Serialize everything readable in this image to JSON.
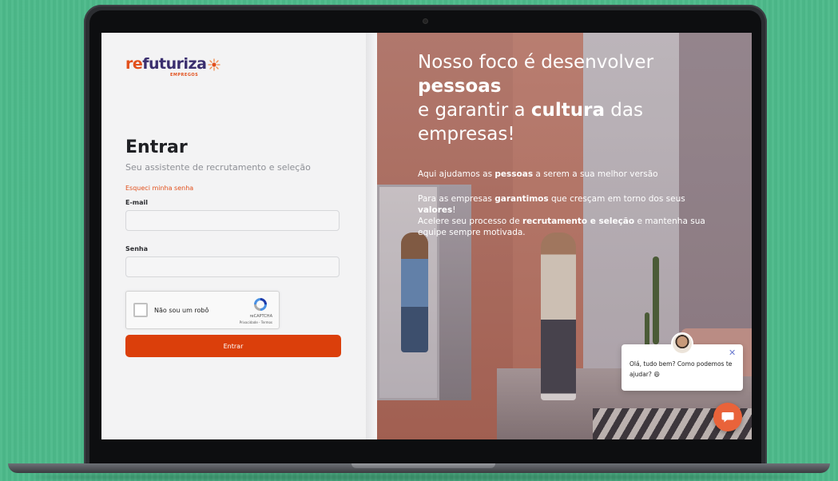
{
  "brand": {
    "logo_re": "re",
    "logo_rest": "futuriza",
    "logo_sub": "EMPREGOS",
    "primary_color": "#e2501c",
    "button_color": "#db3f0b",
    "background_color": "#4cb98a"
  },
  "login": {
    "title": "Entrar",
    "subtitle": "Seu assistente de recrutamento e seleção",
    "forgot_password": "Esqueci minha senha",
    "email_label": "E-mail",
    "email_value": "",
    "password_label": "Senha",
    "password_value": "",
    "submit_label": "Entrar"
  },
  "captcha": {
    "label": "Não sou um robô",
    "brand": "reCAPTCHA",
    "links": "Privacidade - Termos",
    "checked": false
  },
  "hero": {
    "line1": "Nosso foco é desenvolver",
    "line2_bold": "pessoas",
    "line3_pre": "e garantir a ",
    "line3_bold": "cultura",
    "line3_post": " das",
    "line4": "empresas!",
    "p1_pre": "Aqui ajudamos as ",
    "p1_bold": "pessoas",
    "p1_post": " a serem a sua melhor versão",
    "p2_pre": "Para as empresas ",
    "p2_bold": "garantimos",
    "p2_post": " que cresçam em torno dos seus",
    "p2_bold2": "valores",
    "p2_end": "!",
    "p3_pre": "Acelere seu processo de ",
    "p3_bold": "recrutamento e seleção",
    "p3_post": " e mantenha sua",
    "p3_line2": "equipe sempre motivada."
  },
  "chat": {
    "message": "Olá, tudo bem? Como podemos te ajudar? 😄",
    "close_icon": "close-icon",
    "launcher_icon": "chat-bubble-icon"
  }
}
